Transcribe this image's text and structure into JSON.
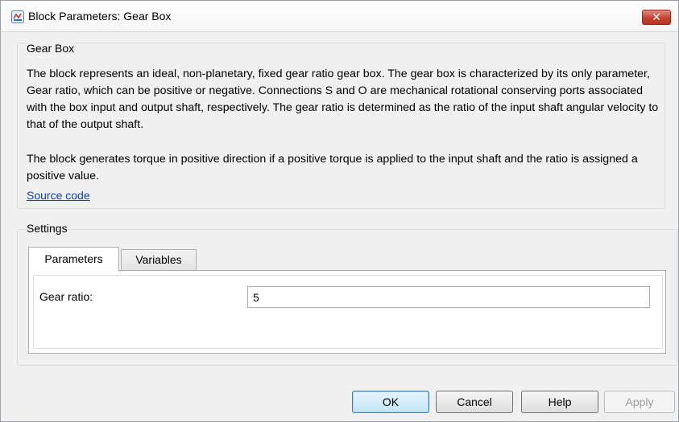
{
  "window": {
    "title": "Block Parameters: Gear Box",
    "close_label": "✕"
  },
  "description": {
    "group_title": "Gear Box",
    "paragraph1": "The block represents an ideal, non-planetary, fixed gear ratio gear box. The gear box is characterized by its only parameter, Gear ratio, which can be positive or negative. Connections S and O are mechanical rotational conserving ports associated with the box input and output shaft, respectively. The gear ratio is determined as the ratio of the input shaft angular velocity to that of the output shaft.",
    "paragraph2": "The block generates torque in positive direction if a positive torque is applied to the input shaft and the ratio is assigned a positive value.",
    "source_link": "Source code"
  },
  "settings": {
    "group_title": "Settings",
    "tabs": [
      {
        "label": "Parameters",
        "active": true
      },
      {
        "label": "Variables",
        "active": false
      }
    ],
    "fields": [
      {
        "label": "Gear ratio:",
        "value": "5"
      }
    ]
  },
  "buttons": {
    "ok": "OK",
    "cancel": "Cancel",
    "help": "Help",
    "apply": "Apply"
  },
  "colors": {
    "link": "#0b3ec0",
    "close_button": "#c7422f",
    "ok_button_border": "#3c7fb1"
  },
  "icons": {
    "app": "simulink-block-icon",
    "close": "close-icon"
  }
}
